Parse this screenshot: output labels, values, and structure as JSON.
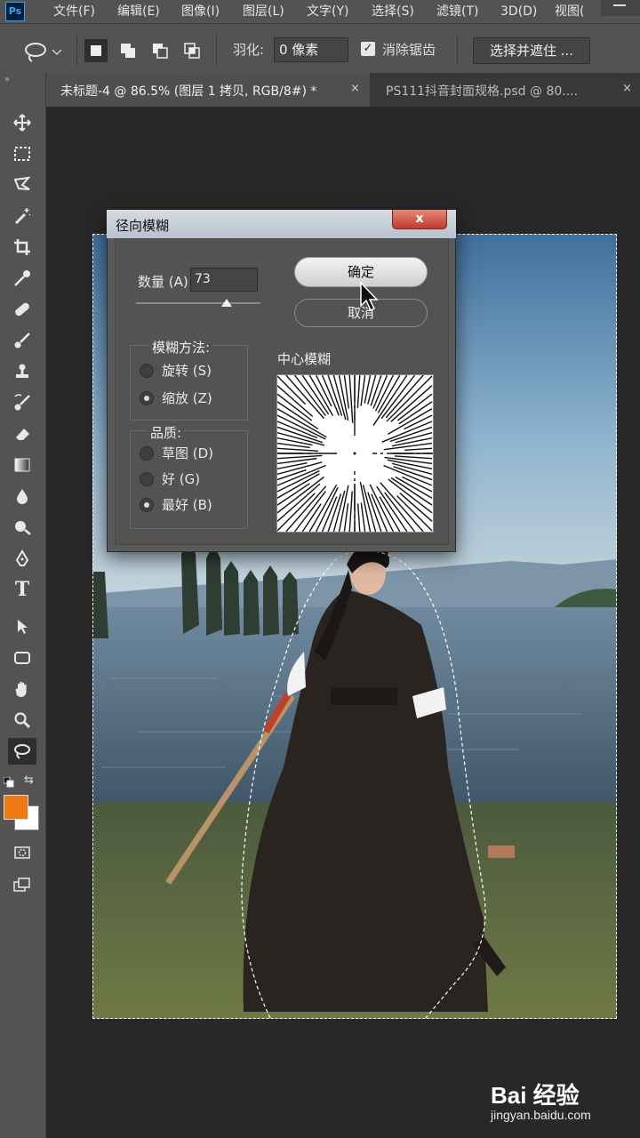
{
  "app": {
    "logo_text": "Ps"
  },
  "menu": [
    {
      "label": "文件(F)"
    },
    {
      "label": "编辑(E)"
    },
    {
      "label": "图像(I)"
    },
    {
      "label": "图层(L)"
    },
    {
      "label": "文字(Y)"
    },
    {
      "label": "选择(S)"
    },
    {
      "label": "滤镜(T)"
    },
    {
      "label": "3D(D)"
    },
    {
      "label": "视图("
    }
  ],
  "options": {
    "feather_label": "羽化:",
    "feather_value": "0 像素",
    "antialias_label": "消除锯齿",
    "antialias_checked": true,
    "select_mask_label": "选择并遮住 ..."
  },
  "tabs": [
    {
      "label": "未标题-4 @ 86.5% (图层 1 拷贝, RGB/8#) *",
      "close": "×",
      "active": true
    },
    {
      "label": "PS111抖音封面规格.psd @ 80....",
      "close": "×",
      "active": false
    }
  ],
  "colors": {
    "foreground": "#f07a12",
    "background": "#ffffff",
    "accent": "#31a8ff"
  },
  "dialog": {
    "title": "径向模糊",
    "close_glyph": "x",
    "amount_label": "数量 (A)",
    "amount_value": "73",
    "amount_fraction": 0.73,
    "ok_label": "确定",
    "cancel_label": "取消",
    "method_group_title": "模糊方法:",
    "methods": [
      {
        "label": "旋转 (S)",
        "checked": false
      },
      {
        "label": "缩放 (Z)",
        "checked": true
      }
    ],
    "quality_group_title": "品质:",
    "qualities": [
      {
        "label": "草图 (D)",
        "checked": false
      },
      {
        "label": "好 (G)",
        "checked": false
      },
      {
        "label": "最好 (B)",
        "checked": true
      }
    ],
    "center_label": "中心模糊"
  },
  "watermark": {
    "logo": "Bai 经验",
    "url": "jingyan.baidu.com"
  }
}
